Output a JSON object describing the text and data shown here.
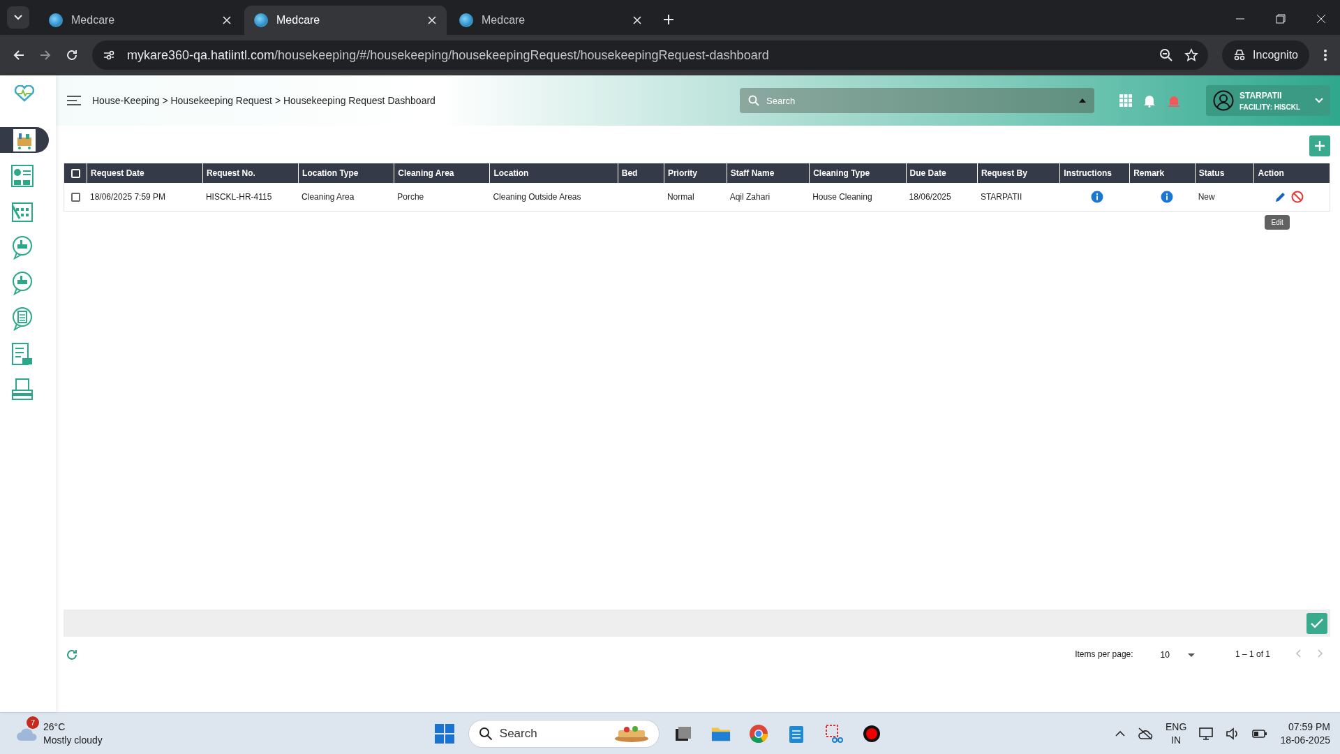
{
  "browser": {
    "tabs": [
      {
        "title": "Medcare",
        "selected": false
      },
      {
        "title": "Medcare",
        "selected": true
      },
      {
        "title": "Medcare",
        "selected": false
      }
    ],
    "url_host": "mykare360-qa.hatiintl.com",
    "url_path": "/housekeeping/#/housekeeping/housekeepingRequest/housekeepingRequest-dashboard",
    "profile": "Incognito"
  },
  "sidebar": {
    "items": [
      {
        "kind": "cart",
        "selected": true
      },
      {
        "kind": "dashboard",
        "selected": false
      },
      {
        "kind": "calendar",
        "selected": false
      },
      {
        "kind": "bubble",
        "selected": false
      },
      {
        "kind": "bubble",
        "selected": false
      },
      {
        "kind": "checklist",
        "selected": false
      },
      {
        "kind": "report",
        "selected": false
      },
      {
        "kind": "printer",
        "selected": false
      }
    ]
  },
  "header": {
    "breadcrumb": "House-Keeping > Housekeeping Request > Housekeeping Request Dashboard",
    "search": {
      "placeholder": "Search"
    },
    "user": {
      "name": "STARPATII",
      "facility": "FACILITY: HISCKL"
    }
  },
  "table": {
    "header_checked": false,
    "columns": [
      {
        "label": "Request Date"
      },
      {
        "label": "Request No."
      },
      {
        "label": "Location Type"
      },
      {
        "label": "Cleaning Area"
      },
      {
        "label": "Location"
      },
      {
        "label": "Bed"
      },
      {
        "label": "Priority"
      },
      {
        "label": "Staff Name"
      },
      {
        "label": "Cleaning Type"
      },
      {
        "label": "Due Date"
      },
      {
        "label": "Request By"
      },
      {
        "label": "Instructions"
      },
      {
        "label": "Remark"
      },
      {
        "label": "Status"
      },
      {
        "label": "Action"
      }
    ],
    "rows": [
      {
        "checked": false,
        "cells": [
          {
            "kind": "text",
            "text": "18/06/2025 7:59 PM"
          },
          {
            "kind": "text",
            "text": "HISCKL-HR-4115"
          },
          {
            "kind": "text",
            "text": "Cleaning Area"
          },
          {
            "kind": "text",
            "text": "Porche"
          },
          {
            "kind": "text",
            "text": "Cleaning Outside Areas"
          },
          {
            "kind": "blank"
          },
          {
            "kind": "text",
            "text": "Normal"
          },
          {
            "kind": "text",
            "text": "Aqil Zahari"
          },
          {
            "kind": "text",
            "text": "House Cleaning"
          },
          {
            "kind": "text",
            "text": "18/06/2025"
          },
          {
            "kind": "text",
            "text": "STARPATII"
          },
          {
            "kind": "info"
          },
          {
            "kind": "info"
          },
          {
            "kind": "text",
            "text": "New"
          },
          {
            "kind": "actions",
            "tooltip": "Edit"
          }
        ]
      }
    ]
  },
  "paginator": {
    "label": "Items per page:",
    "page_size": "10",
    "range": "1 – 1 of 1"
  },
  "taskbar": {
    "weather_badge": "7",
    "temperature": "26°C",
    "condition": "Mostly cloudy",
    "search_placeholder": "Search",
    "lang": "ENG",
    "region": "IN",
    "time": "07:59 PM",
    "date": "18-06-2025"
  }
}
